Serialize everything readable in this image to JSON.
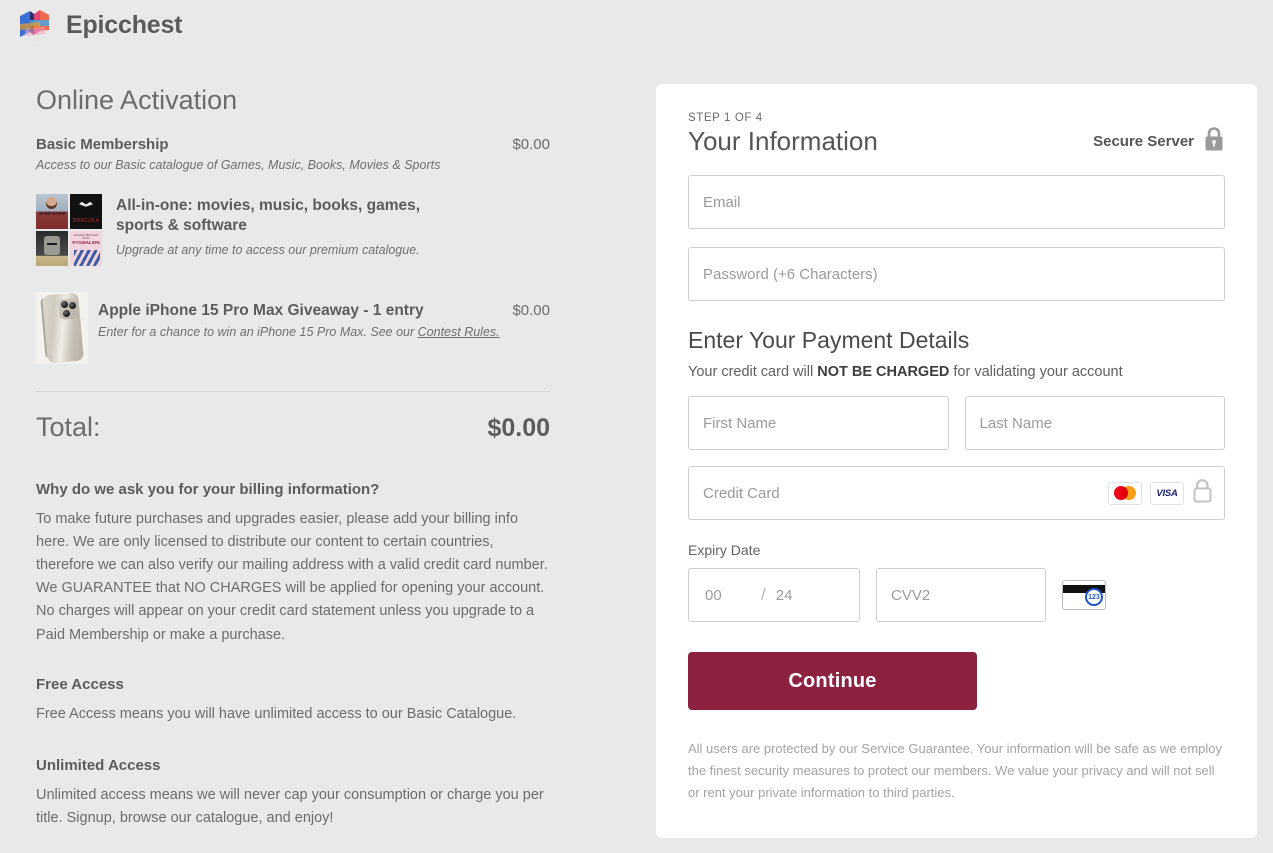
{
  "header": {
    "brand": "Epicchest",
    "logo_icon": "epicchest-logo-icon"
  },
  "left": {
    "page_title": "Online Activation",
    "basic": {
      "title": "Basic Membership",
      "price": "$0.00",
      "subtitle": "Access to our Basic catalogue of Games, Music, Books, Movies & Sports"
    },
    "promo": {
      "title": "All-in-one: movies, music, books, games, sports & software",
      "subtitle": "Upgrade at any time to access our premium catalogue.",
      "covers": [
        "JANE EYRE",
        "DRACULA",
        "FRANKENSTEIN",
        "PYGMALION"
      ]
    },
    "giveaway": {
      "title": "Apple iPhone 15 Pro Max Giveaway - 1 entry",
      "price": "$0.00",
      "subtitle_before": "Enter for a chance to win an iPhone 15 Pro Max. See our ",
      "link_text": "Contest Rules."
    },
    "total": {
      "label": "Total:",
      "value": "$0.00"
    },
    "info": [
      {
        "heading": "Why do we ask you for your billing information?",
        "body": "To make future purchases and upgrades easier, please add your billing info here. We are only licensed to distribute our content to certain countries, therefore we can also verify our mailing address with a valid credit card number. We GUARANTEE that NO CHARGES will be applied for opening your account. No charges will appear on your credit card statement unless you upgrade to a Paid Membership or make a purchase."
      },
      {
        "heading": "Free Access",
        "body": "Free Access means you will have unlimited access to our Basic Catalogue."
      },
      {
        "heading": "Unlimited Access",
        "body": "Unlimited access means we will never cap your consumption or charge you per title. Signup, browse our catalogue, and enjoy!"
      }
    ]
  },
  "panel": {
    "step": "STEP 1 OF 4",
    "title": "Your Information",
    "secure_label": "Secure Server",
    "secure_icon": "lock-icon",
    "email": {
      "placeholder": "Email",
      "value": ""
    },
    "password": {
      "placeholder": "Password (+6 Characters)",
      "value": ""
    },
    "payment": {
      "heading": "Enter Your Payment Details",
      "note_before": "Your credit card will ",
      "note_strong": "NOT BE CHARGED",
      "note_after": " for validating your account",
      "first_name": {
        "placeholder": "First Name",
        "value": ""
      },
      "last_name": {
        "placeholder": "Last Name",
        "value": ""
      },
      "credit_card": {
        "placeholder": "Credit Card",
        "value": ""
      },
      "card_icons": [
        "mastercard-icon",
        "visa-icon",
        "lock-icon"
      ],
      "expiry_label": "Expiry Date",
      "expiry_month": {
        "placeholder": "00",
        "value": ""
      },
      "expiry_separator": "/",
      "expiry_year": {
        "placeholder": "24",
        "value": ""
      },
      "cvv": {
        "placeholder": "CVV2",
        "value": ""
      },
      "cvv_hint_icon": "card-back-cvv-icon",
      "cvv_hint_digits": "123"
    },
    "continue_label": "Continue",
    "guarantee": "All users are protected by our Service Guarantee. Your information will be safe as we employ the finest security measures to protect our members. We value your privacy and will not sell or rent your private information to third parties."
  },
  "colors": {
    "page_background": "#e9e9e9",
    "panel_background": "#ffffff",
    "accent_button": "#8c2140",
    "text_primary": "#5a5a5a",
    "placeholder": "#9b9b9b",
    "visa_blue": "#1a1f71",
    "mastercard_red": "#eb001b",
    "mastercard_orange": "#f79e1b"
  }
}
